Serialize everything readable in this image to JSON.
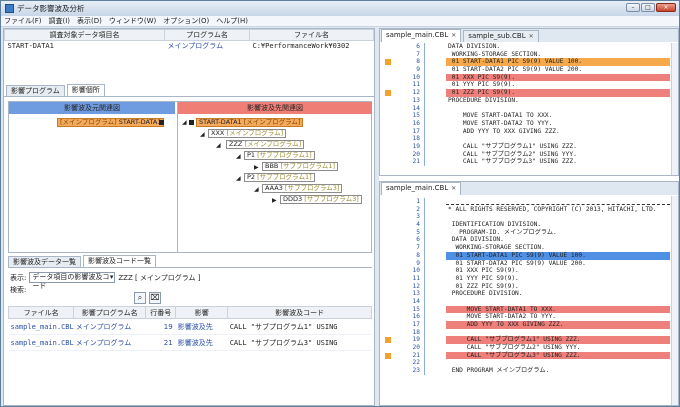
{
  "window": {
    "title": "データ影響波及分析"
  },
  "menu": [
    "ファイル(F)",
    "調査(I)",
    "表示(D)",
    "ウィンドウ(W)",
    "オプション(O)",
    "ヘルプ(H)"
  ],
  "target_table": {
    "headers": [
      "調査対象データ項目名",
      "プログラム名",
      "ファイル名"
    ],
    "row": [
      "START-DATA1",
      "メインプログラム",
      "C:¥PerformanceWork¥0302"
    ]
  },
  "upper_tabs": [
    "影響プログラム",
    "影響個所"
  ],
  "graph": {
    "left_header": "影響波及元関連図",
    "right_header": "影響波及先関連図",
    "left_node": {
      "prog": "[メインプログラム]",
      "item": "START-DATA1"
    },
    "right_nodes": [
      {
        "item": "START-DATA1",
        "prog": "[メインプログラム]"
      },
      {
        "item": "XXX",
        "prog": "[メインプログラム]"
      },
      {
        "item": "ZZZ",
        "prog": "[メインプログラム]"
      },
      {
        "item": "P1",
        "prog": "[サブプログラム1]"
      },
      {
        "item": "BBB",
        "prog": "[サブプログラム1]"
      },
      {
        "item": "P2",
        "prog": "[サブプログラム1]"
      },
      {
        "item": "AAA3",
        "prog": "[サブプログラム3]"
      },
      {
        "item": "DDD3",
        "prog": "[サブプログラム3]"
      }
    ]
  },
  "lower_tabs": [
    "影響波及データ一覧",
    "影響波及コード一覧"
  ],
  "filter": {
    "display_label": "表示:",
    "select_value": "データ項目の影響波及コード",
    "target": "ZZZ [ メインプログラム ]",
    "search_label": "検索:"
  },
  "code_table": {
    "headers": [
      "ファイル名",
      "影響プログラム名",
      "行番号",
      "影響",
      "影響波及コード"
    ],
    "rows": [
      [
        "sample_main.CBL",
        "メインプログラム",
        "19",
        "影響波及先",
        "CALL \"サブプログラム1\" USING"
      ],
      [
        "sample_main.CBL",
        "メインプログラム",
        "21",
        "影響波及先",
        "CALL \"サブプログラム3\" USING"
      ]
    ]
  },
  "editor_top": {
    "tabs": [
      "sample_main.CBL",
      "sample_sub.CBL"
    ],
    "lines": [
      {
        "n": "6",
        "t": "DATA DIVISION.",
        "h": "",
        "m": false
      },
      {
        "n": "7",
        "t": " WORKING-STORAGE SECTION.",
        "h": "",
        "m": false
      },
      {
        "n": "8",
        "t": " 01 START-DATA1 PIC S9(9) VALUE 100.",
        "h": "orange",
        "m": true
      },
      {
        "n": "9",
        "t": " 01 START-DATA2 PIC S9(9) VALUE 200.",
        "h": "",
        "m": false
      },
      {
        "n": "10",
        "t": " 01 XXX PIC S9(9).",
        "h": "red",
        "m": false
      },
      {
        "n": "11",
        "t": " 01 YYY PIC S9(9).",
        "h": "",
        "m": false
      },
      {
        "n": "12",
        "t": " 01 ZZZ PIC S9(9).",
        "h": "red",
        "m": true
      },
      {
        "n": "13",
        "t": "PROCEDURE DIVISION.",
        "h": "",
        "m": false
      },
      {
        "n": "14",
        "t": "",
        "h": "",
        "m": false
      },
      {
        "n": "15",
        "t": "    MOVE START-DATA1 TO XXX.",
        "h": "",
        "m": false
      },
      {
        "n": "16",
        "t": "    MOVE START-DATA2 TO YYY.",
        "h": "",
        "m": false
      },
      {
        "n": "17",
        "t": "    ADD YYY TO XXX GIVING ZZZ.",
        "h": "",
        "m": false
      },
      {
        "n": "18",
        "t": "",
        "h": "",
        "m": false
      },
      {
        "n": "19",
        "t": "    CALL \"サブプログラム1\" USING ZZZ.",
        "h": "",
        "m": false
      },
      {
        "n": "20",
        "t": "    CALL \"サブプログラム2\" USING YYY.",
        "h": "",
        "m": false
      },
      {
        "n": "21",
        "t": "    CALL \"サブプログラム3\" USING ZZZ.",
        "h": "",
        "m": false
      }
    ]
  },
  "editor_bottom": {
    "tabs": [
      "sample_main.CBL"
    ],
    "lines": [
      {
        "n": "1",
        "t": "",
        "h": "",
        "m": false
      },
      {
        "n": "2",
        "t": "* ALL RIGHTS RESERVED, COPYRIGHT (C) 2013, HITACHI, LTD.",
        "h": "",
        "m": false
      },
      {
        "n": "3",
        "t": "",
        "h": "",
        "m": false
      },
      {
        "n": "4",
        "t": " IDENTIFICATION DIVISION.",
        "h": "",
        "m": false
      },
      {
        "n": "5",
        "t": "   PROGRAM-ID. メインプログラム.",
        "h": "",
        "m": false
      },
      {
        "n": "6",
        "t": " DATA DIVISION.",
        "h": "",
        "m": false
      },
      {
        "n": "7",
        "t": "  WORKING-STORAGE SECTION.",
        "h": "",
        "m": false
      },
      {
        "n": "8",
        "t": "  01 START-DATA1 PIC S9(9) VALUE 100.",
        "h": "blue",
        "m": false
      },
      {
        "n": "9",
        "t": "  01 START-DATA2 PIC S9(9) VALUE 200.",
        "h": "",
        "m": false
      },
      {
        "n": "10",
        "t": "  01 XXX PIC S9(9).",
        "h": "",
        "m": false
      },
      {
        "n": "11",
        "t": "  01 YYY PIC S9(9).",
        "h": "",
        "m": false
      },
      {
        "n": "12",
        "t": "  01 ZZZ PIC S9(9).",
        "h": "",
        "m": false
      },
      {
        "n": "13",
        "t": " PROCEDURE DIVISION.",
        "h": "",
        "m": false
      },
      {
        "n": "14",
        "t": "",
        "h": "",
        "m": false
      },
      {
        "n": "15",
        "t": "     MOVE START-DATA1 TO XXX.",
        "h": "red",
        "m": false
      },
      {
        "n": "16",
        "t": "     MOVE START-DATA2 TO YYY.",
        "h": "",
        "m": false
      },
      {
        "n": "17",
        "t": "     ADD YYY TO XXX GIVING ZZZ.",
        "h": "red",
        "m": false
      },
      {
        "n": "18",
        "t": "",
        "h": "",
        "m": false
      },
      {
        "n": "19",
        "t": "     CALL \"サブプログラム1\" USING ZZZ.",
        "h": "red",
        "m": true
      },
      {
        "n": "20",
        "t": "     CALL \"サブプログラム2\" USING YYY.",
        "h": "",
        "m": false
      },
      {
        "n": "21",
        "t": "     CALL \"サブプログラム3\" USING ZZZ.",
        "h": "red",
        "m": true
      },
      {
        "n": "22",
        "t": "",
        "h": "",
        "m": false
      },
      {
        "n": "23",
        "t": " END PROGRAM メインプログラム.",
        "h": "",
        "m": false
      }
    ]
  },
  "colors": {
    "highlight_orange": "#f5a94a",
    "highlight_red": "#ef7f7a",
    "highlight_blue": "#4f8fe4",
    "left_header": "#6f9be0",
    "right_header": "#ef7f76"
  }
}
